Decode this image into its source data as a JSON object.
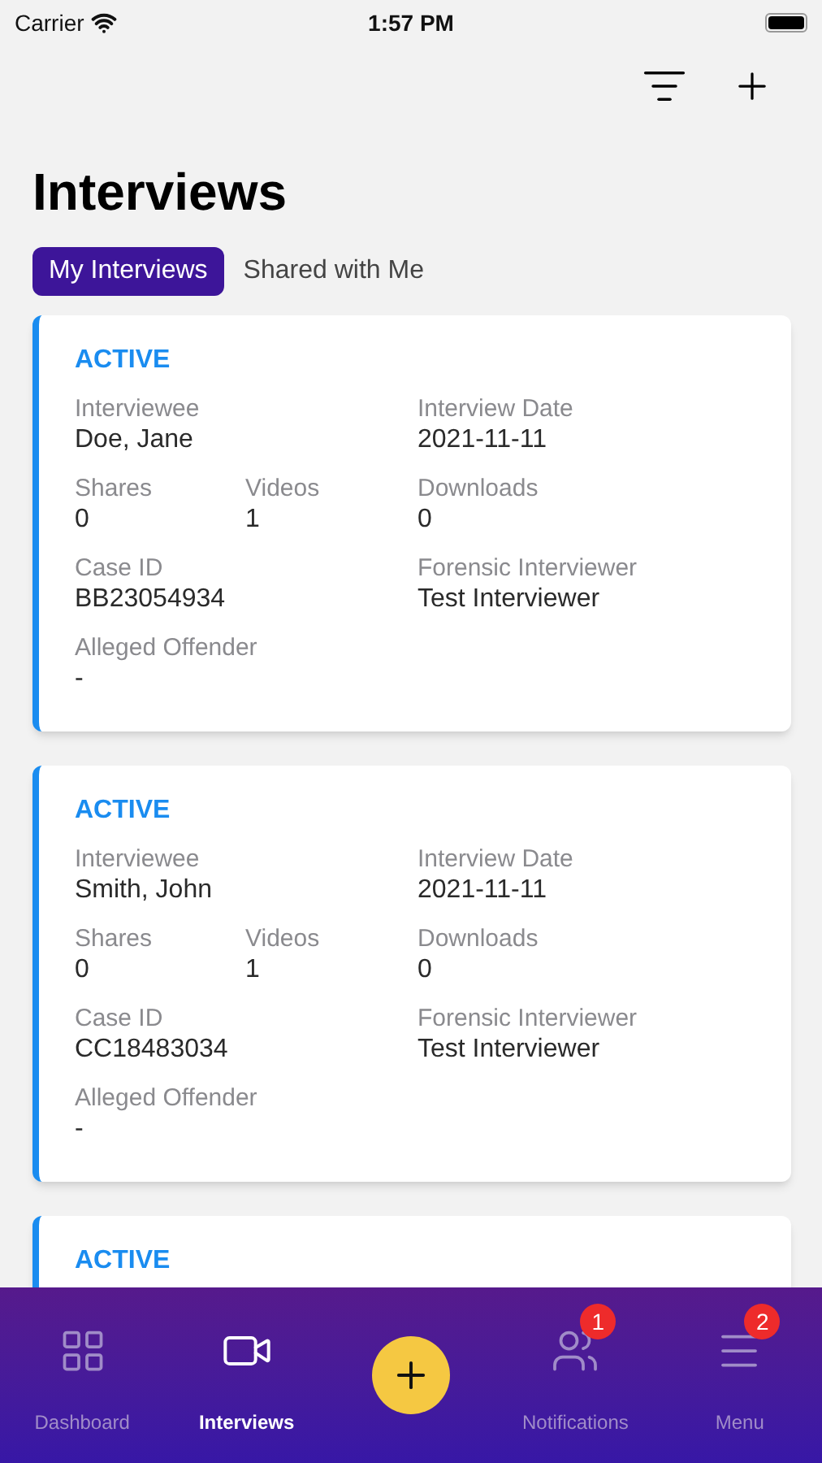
{
  "status_bar": {
    "carrier": "Carrier",
    "time": "1:57 PM"
  },
  "title": "Interviews",
  "tabs": [
    {
      "label": "My Interviews",
      "selected": true
    },
    {
      "label": "Shared with Me",
      "selected": false
    }
  ],
  "cards": [
    {
      "status": "ACTIVE",
      "fields": [
        {
          "label": "Interviewee",
          "value": "Doe, Jane"
        },
        {
          "label": "Interview Date",
          "value": "2021-11-11"
        },
        {
          "label": "Shares",
          "value": "0"
        },
        {
          "label": "Videos",
          "value": "1"
        },
        {
          "label": "Downloads",
          "value": "0"
        },
        {
          "label": "Case ID",
          "value": "BB23054934"
        },
        {
          "label": "Forensic Interviewer",
          "value": "Test Interviewer"
        },
        {
          "label": "Alleged Offender",
          "value": "-"
        }
      ]
    },
    {
      "status": "ACTIVE",
      "fields": [
        {
          "label": "Interviewee",
          "value": "Smith, John"
        },
        {
          "label": "Interview Date",
          "value": "2021-11-11"
        },
        {
          "label": "Shares",
          "value": "0"
        },
        {
          "label": "Videos",
          "value": "1"
        },
        {
          "label": "Downloads",
          "value": "0"
        },
        {
          "label": "Case ID",
          "value": "CC18483034"
        },
        {
          "label": "Forensic Interviewer",
          "value": "Test Interviewer"
        },
        {
          "label": "Alleged Offender",
          "value": "-"
        }
      ]
    },
    {
      "status": "ACTIVE"
    }
  ],
  "nav": [
    {
      "kind": "dashboard",
      "label": "Dashboard",
      "selected": false
    },
    {
      "kind": "interviews",
      "label": "Interviews",
      "selected": true
    },
    {
      "kind": "add"
    },
    {
      "kind": "notifications",
      "label": "Notifications",
      "selected": false,
      "badge": "1"
    },
    {
      "kind": "menu",
      "label": "Menu",
      "selected": false,
      "badge": "2"
    }
  ]
}
